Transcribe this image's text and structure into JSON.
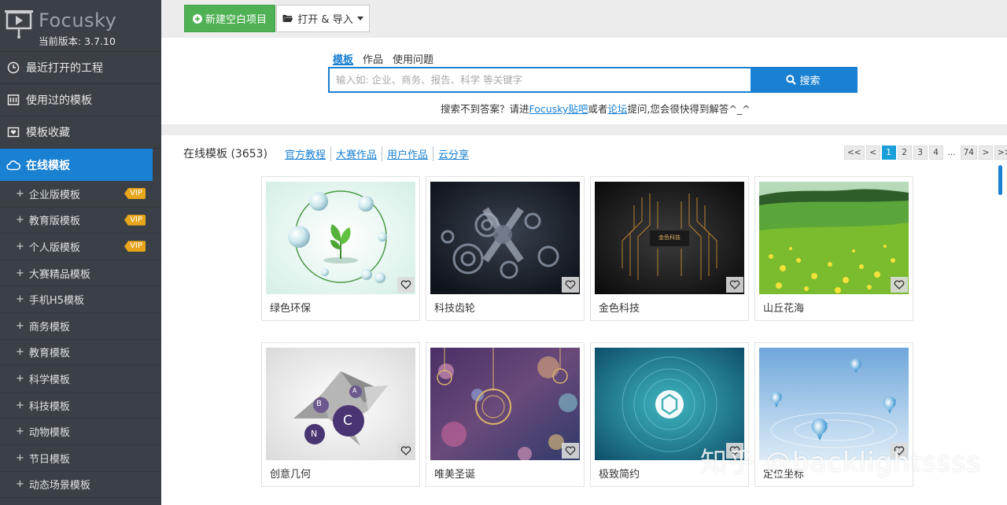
{
  "app": {
    "name": "Focusky",
    "version": "当前版本: 3.7.10"
  },
  "sidebar": {
    "nav": [
      {
        "label": "最近打开的工程",
        "icon": "clock-icon"
      },
      {
        "label": "使用过的模板",
        "icon": "template-icon"
      },
      {
        "label": "模板收藏",
        "icon": "heart-box-icon"
      },
      {
        "label": "在线模板",
        "icon": "cloud-icon",
        "active": true
      }
    ],
    "sub_items": [
      {
        "label": "企业版模板",
        "badge": "VIP"
      },
      {
        "label": "教育版模板",
        "badge": "VIP"
      },
      {
        "label": "个人版模板",
        "badge": "VIP"
      },
      {
        "label": "大赛精品模板"
      },
      {
        "label": "手机H5模板"
      },
      {
        "label": "商务模板"
      },
      {
        "label": "教育模板"
      },
      {
        "label": "科学模板"
      },
      {
        "label": "科技模板"
      },
      {
        "label": "动物模板"
      },
      {
        "label": "节日模板"
      },
      {
        "label": "动态场景模板"
      }
    ],
    "plus": "+"
  },
  "toolbar": {
    "new_label": "新建空白项目",
    "open_label": "打开 & 导入"
  },
  "search": {
    "tabs": [
      "模板",
      "作品",
      "使用问题"
    ],
    "placeholder": "输入如: 企业、商务、报告、科学 等关键字",
    "button": "搜索",
    "help_prefix": "搜索不到答案？请进",
    "help_link1": "Focusky贴吧",
    "help_mid": "或者",
    "help_link2": "论坛",
    "help_suffix": "提问,您会很快得到解答^_^"
  },
  "content": {
    "title": "在线模板 (3653)",
    "links": [
      "官方教程",
      "大赛作品",
      "用户作品",
      "云分享"
    ],
    "pager": [
      "<<",
      "<",
      "1",
      "2",
      "3",
      "4",
      "...",
      "74",
      ">",
      ">>"
    ],
    "pager_active": "1",
    "cards": [
      {
        "label": "绿色环保"
      },
      {
        "label": "科技齿轮"
      },
      {
        "label": "金色科技",
        "inner_text": "金色科技"
      },
      {
        "label": "山丘花海"
      },
      {
        "label": "创意几何",
        "inner_labels": [
          "B",
          "A",
          "C",
          "N"
        ]
      },
      {
        "label": "唯美圣诞"
      },
      {
        "label": "极致简约"
      },
      {
        "label": "定位坐标"
      }
    ]
  },
  "watermark": "知乎 @backlightssss",
  "colors": {
    "accent": "#1a80d2",
    "sidebar": "#3a4046",
    "green": "#4fb154",
    "vip": "#e7a51c"
  }
}
